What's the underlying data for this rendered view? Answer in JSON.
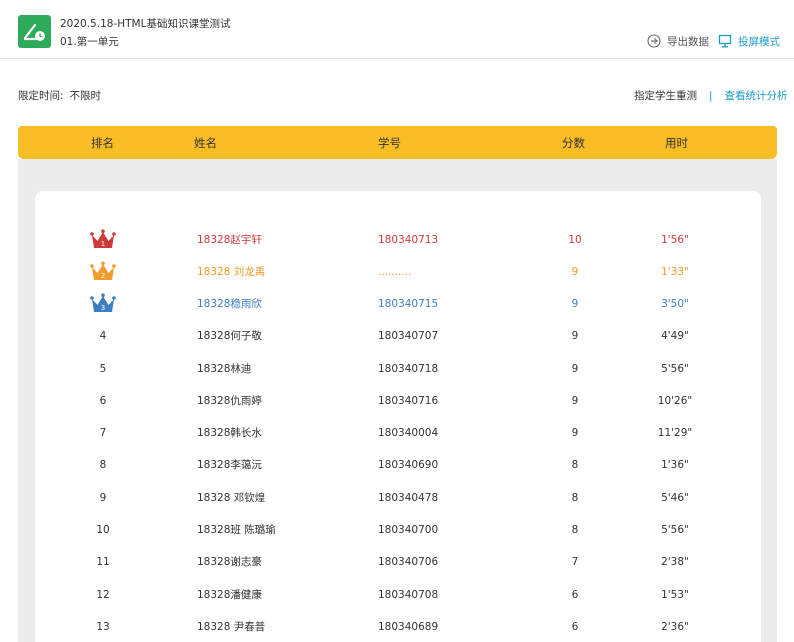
{
  "header": {
    "title": "2020.5.18-HTML基础知识课堂测试",
    "subtitle": "01.第一单元",
    "export_label": "导出数据",
    "screen_label": "投屏模式"
  },
  "info": {
    "time_limit_label": "限定时间:",
    "time_limit_value": "不限时",
    "retest_label": "指定学生重测",
    "separator": "|",
    "stats_label": "查看统计分析"
  },
  "columns": {
    "rank": "排名",
    "name": "姓名",
    "id": "学号",
    "score": "分数",
    "time": "用时"
  },
  "colors": {
    "accent": "#f8bd25",
    "link": "#1a9bc9",
    "gold": "#d0393c",
    "silver": "#f29a2b",
    "bronze": "#3d7ec2"
  },
  "rows": [
    {
      "rank": "1",
      "name": "18328赵宇轩",
      "id": "180340713",
      "score": "10",
      "time": "1'56\"",
      "crown": "crown-gold-icon"
    },
    {
      "rank": "2",
      "name": "18328 刘龙禹",
      "id": "..........",
      "score": "9",
      "time": "1'33\"",
      "crown": "crown-orange-icon"
    },
    {
      "rank": "3",
      "name": "18328稳雨欣",
      "id": "180340715",
      "score": "9",
      "time": "3'50\"",
      "crown": "crown-blue-icon"
    },
    {
      "rank": "4",
      "name": "18328何子敬",
      "id": "180340707",
      "score": "9",
      "time": "4'49\""
    },
    {
      "rank": "5",
      "name": "18328林迪",
      "id": "180340718",
      "score": "9",
      "time": "5'56\""
    },
    {
      "rank": "6",
      "name": "18328仇雨婷",
      "id": "180340716",
      "score": "9",
      "time": "10'26\""
    },
    {
      "rank": "7",
      "name": "18328韩长水",
      "id": "180340004",
      "score": "9",
      "time": "11'29\""
    },
    {
      "rank": "8",
      "name": "18328李蔼沅",
      "id": "180340690",
      "score": "8",
      "time": "1'36\""
    },
    {
      "rank": "9",
      "name": "18328 邓钦煌",
      "id": "180340478",
      "score": "8",
      "time": "5'46\""
    },
    {
      "rank": "10",
      "name": "18328班 陈璐瑜",
      "id": "180340700",
      "score": "8",
      "time": "5'56\""
    },
    {
      "rank": "11",
      "name": "18328谢志豪",
      "id": "180340706",
      "score": "7",
      "time": "2'38\""
    },
    {
      "rank": "12",
      "name": "18328潘健康",
      "id": "180340708",
      "score": "6",
      "time": "1'53\""
    },
    {
      "rank": "13",
      "name": "18328 尹春普",
      "id": "180340689",
      "score": "6",
      "time": "2'36\""
    }
  ]
}
